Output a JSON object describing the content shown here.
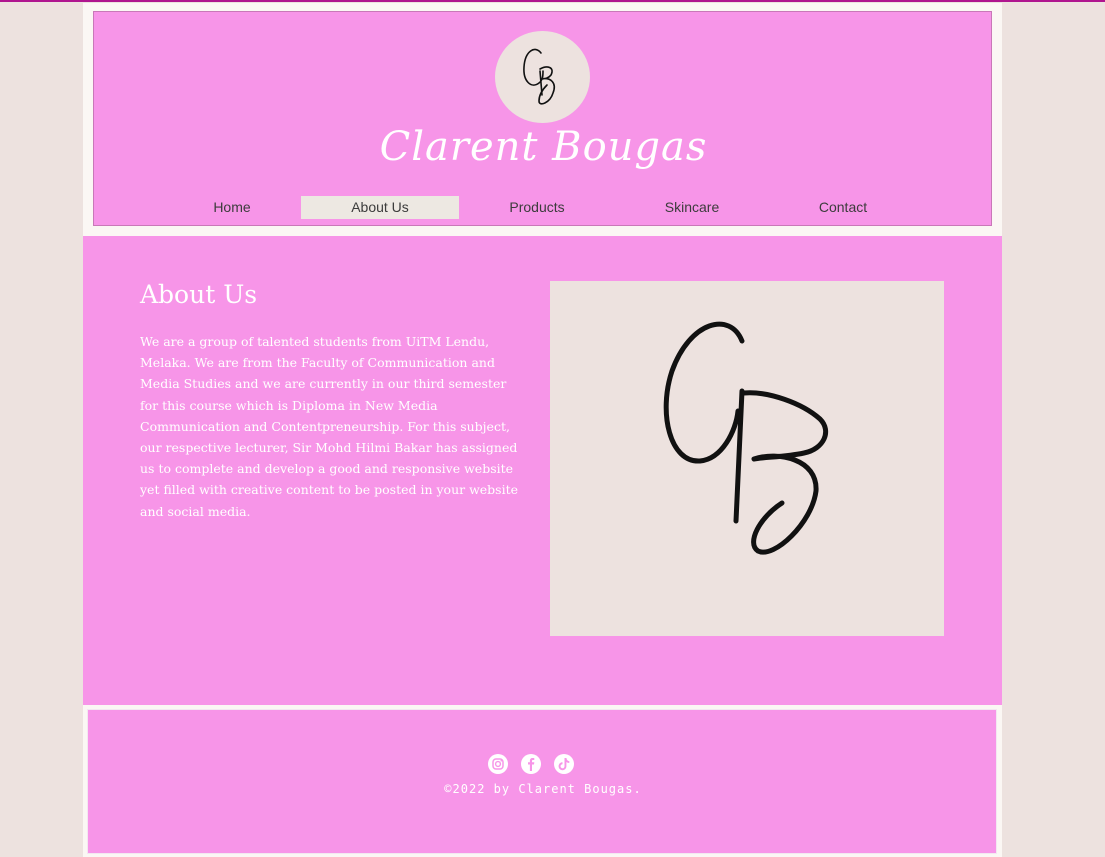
{
  "colors": {
    "background": "#ede2df",
    "accent_pink": "#f795e8",
    "top_rule": "#b0158f",
    "nav_active_bg": "#ede8e2",
    "text_white": "#ffffff",
    "nav_text": "#3c3c3c"
  },
  "header": {
    "logo_icon": "cb-monogram-icon",
    "site_title": "Clarent Bougas"
  },
  "nav": {
    "items": [
      {
        "label": "Home",
        "active": false
      },
      {
        "label": "About Us",
        "active": true
      },
      {
        "label": "Products",
        "active": false
      },
      {
        "label": "Skincare",
        "active": false
      },
      {
        "label": "Contact",
        "active": false
      }
    ]
  },
  "about": {
    "title": "About Us",
    "body": "We are a group of talented students from UiTM Lendu, Melaka. We are from the Faculty of Communication and Media Studies and we are currently in our third semester for this course which is Diploma in New Media Communication and Contentpreneurship. For this subject, our respective lecturer, Sir Mohd Hilmi Bakar has assigned us to complete and develop a good and responsive website yet filled with creative content to be posted in your website and social media.",
    "image_icon": "cb-monogram-icon"
  },
  "footer": {
    "social": [
      {
        "icon": "instagram-icon"
      },
      {
        "icon": "facebook-icon"
      },
      {
        "icon": "tiktok-icon"
      }
    ],
    "copyright": "©2022 by Clarent Bougas."
  }
}
